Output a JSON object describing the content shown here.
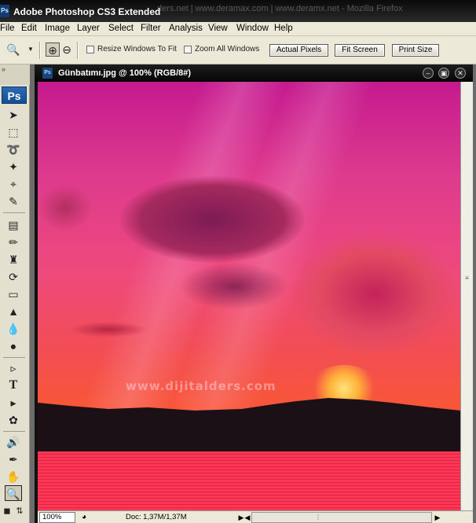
{
  "app": {
    "title": "Adobe Photoshop CS3 Extended",
    "background_title": "ders.net | www.deramax.com | www.deramx.net - Mozilla Firefox",
    "badge": "Ps"
  },
  "menu": [
    "File",
    "Edit",
    "Image",
    "Layer",
    "Select",
    "Filter",
    "Analysis",
    "View",
    "Window",
    "Help"
  ],
  "options": {
    "resize_label": "Resize Windows To Fit",
    "zoom_all_label": "Zoom All Windows",
    "actual_pixels": "Actual Pixels",
    "fit_screen": "Fit Screen",
    "print_size": "Print Size"
  },
  "toolbox": {
    "logo": "Ps",
    "grip": "»"
  },
  "document": {
    "title": "Günbatımı.jpg @ 100% (RGB/8#)",
    "watermark": "www.dijitalders.com"
  },
  "status": {
    "zoom": "100%",
    "doc_info": "Doc: 1,37M/1,37M"
  },
  "colors": {
    "sky_top": "#c51a8f",
    "sky_bottom": "#ff4d2a",
    "accent": "#2e6bb3"
  }
}
